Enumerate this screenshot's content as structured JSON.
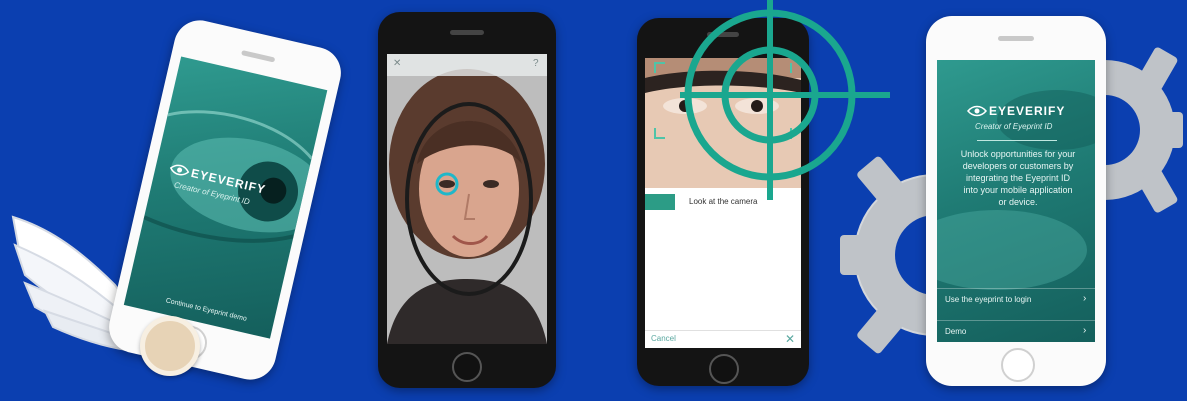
{
  "phone1": {
    "brand": "EYEVERIFY",
    "tagline": "Creator of Eyeprint ID",
    "footer": "Continue to Eyeprint demo"
  },
  "phone2": {
    "top_left": "✕",
    "top_right": "?"
  },
  "phone3": {
    "instruction": "Look at the camera",
    "cancel": "Cancel",
    "close": "✕"
  },
  "phone4": {
    "brand": "EYEVERIFY",
    "tagline": "Creator of Eyeprint ID",
    "description": "Unlock opportunities for your developers or customers by integrating the Eyeprint ID into your mobile application or device.",
    "menu_items": [
      {
        "label": "Use the eyeprint to login"
      },
      {
        "label": "Demo"
      }
    ]
  },
  "colors": {
    "background": "#0b3fb0",
    "teal": "#1f7b74",
    "reticle": "#1aa78f",
    "gear": "#bfc3c8"
  }
}
